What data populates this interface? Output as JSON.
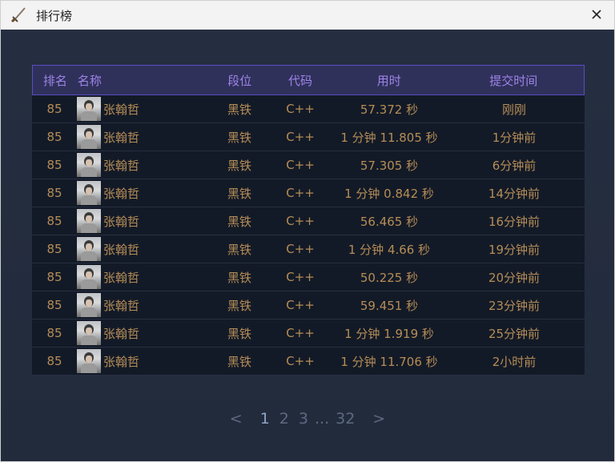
{
  "window": {
    "title": "排行榜"
  },
  "table": {
    "headers": {
      "rank": "排名",
      "name": "名称",
      "tier": "段位",
      "code": "代码",
      "time": "用时",
      "submit": "提交时间"
    },
    "rows": [
      {
        "rank": "85",
        "name": "张翰哲",
        "tier": "黑铁",
        "code": "C++",
        "time": "57.372 秒",
        "submit": "刚刚"
      },
      {
        "rank": "85",
        "name": "张翰哲",
        "tier": "黑铁",
        "code": "C++",
        "time": "1 分钟 11.805 秒",
        "submit": "1分钟前"
      },
      {
        "rank": "85",
        "name": "张翰哲",
        "tier": "黑铁",
        "code": "C++",
        "time": "57.305 秒",
        "submit": "6分钟前"
      },
      {
        "rank": "85",
        "name": "张翰哲",
        "tier": "黑铁",
        "code": "C++",
        "time": "1 分钟 0.842 秒",
        "submit": "14分钟前"
      },
      {
        "rank": "85",
        "name": "张翰哲",
        "tier": "黑铁",
        "code": "C++",
        "time": "56.465 秒",
        "submit": "16分钟前"
      },
      {
        "rank": "85",
        "name": "张翰哲",
        "tier": "黑铁",
        "code": "C++",
        "time": "1 分钟 4.66 秒",
        "submit": "19分钟前"
      },
      {
        "rank": "85",
        "name": "张翰哲",
        "tier": "黑铁",
        "code": "C++",
        "time": "50.225 秒",
        "submit": "20分钟前"
      },
      {
        "rank": "85",
        "name": "张翰哲",
        "tier": "黑铁",
        "code": "C++",
        "time": "59.451 秒",
        "submit": "23分钟前"
      },
      {
        "rank": "85",
        "name": "张翰哲",
        "tier": "黑铁",
        "code": "C++",
        "time": "1 分钟 1.919 秒",
        "submit": "25分钟前"
      },
      {
        "rank": "85",
        "name": "张翰哲",
        "tier": "黑铁",
        "code": "C++",
        "time": "1 分钟 11.706 秒",
        "submit": "2小时前"
      }
    ]
  },
  "pagination": {
    "prev": "<",
    "pages": [
      "1",
      "2",
      "3"
    ],
    "ellipsis": "...",
    "last": "32",
    "next": ">",
    "current": "1"
  },
  "colors": {
    "background": "#252e40",
    "header_bg": "#30315a",
    "header_border": "#5b4bc6",
    "header_text": "#9d84e8",
    "row_bg": "#131a27",
    "row_text": "#b58d57",
    "page_text": "#5d6a82",
    "page_current": "#8fa3c4"
  },
  "icons": {
    "app": "sword-icon",
    "close": "close-icon",
    "avatar": "user-photo"
  }
}
